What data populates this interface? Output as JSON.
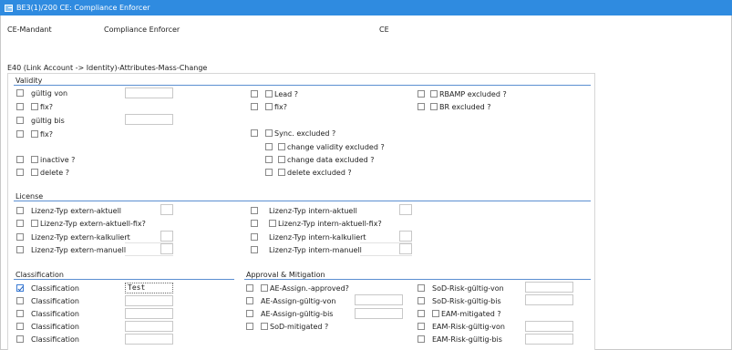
{
  "window": {
    "title": "BE3(1)/200 CE: Compliance Enforcer"
  },
  "header": {
    "mandant_label": "CE-Mandant",
    "mandant_value": "Compliance Enforcer",
    "code": "CE"
  },
  "form": {
    "title": "E40 (Link Account -> Identity)-Attributes-Mass-Change"
  },
  "validity": {
    "title": "Validity",
    "gueltig_von": "gültig von",
    "fix1": "fix?",
    "gueltig_bis": "gültig bis",
    "fix2": "fix?",
    "inactive": "inactive ?",
    "delete": "delete ?",
    "lead": "Lead ?",
    "fix3": "fix?",
    "sync_excluded": "Sync. excluded ?",
    "change_validity_excluded": "change validity excluded ?",
    "change_data_excluded": "change data excluded ?",
    "delete_excluded": "delete excluded ?",
    "rbamp_excluded": "RBAMP excluded ?",
    "br_excluded": "BR excluded ?"
  },
  "license": {
    "title": "License",
    "ext_aktuell": "Lizenz-Typ extern-aktuell",
    "ext_aktuell_fix": "Lizenz-Typ extern-aktuell-fix?",
    "ext_kalkuliert": "Lizenz-Typ extern-kalkuliert",
    "ext_manuell": "Lizenz-Typ extern-manuell",
    "int_aktuell": "Lizenz-Typ intern-aktuell",
    "int_aktuell_fix": "Lizenz-Typ intern-aktuell-fix?",
    "int_kalkuliert": "Lizenz-Typ intern-kalkuliert",
    "int_manuell": "Lizenz-Typ intern-manuell"
  },
  "classification": {
    "title": "Classification",
    "rows": [
      {
        "label": "Classification",
        "value": "Test",
        "checked": true
      },
      {
        "label": "Classification",
        "value": "",
        "checked": false
      },
      {
        "label": "Classification",
        "value": "",
        "checked": false
      },
      {
        "label": "Classification",
        "value": "",
        "checked": false
      },
      {
        "label": "Classification",
        "value": "",
        "checked": false
      }
    ]
  },
  "approval": {
    "title": "Approval & Mitigation",
    "ae_approved": "AE-Assign.-approved?",
    "ae_gueltig_von": "AE-Assign-gültig-von",
    "ae_gueltig_bis": "AE-Assign-gültig-bis",
    "sod_mitigated": "SoD-mitigated ?",
    "sod_risk_von": "SoD-Risk-gültig-von",
    "sod_risk_bis": "SoD-Risk-gültig-bis",
    "eam_mitigated": "EAM-mitigated ?",
    "eam_risk_von": "EAM-Risk-gültig-von",
    "eam_risk_bis": "EAM-Risk-gültig-bis"
  }
}
